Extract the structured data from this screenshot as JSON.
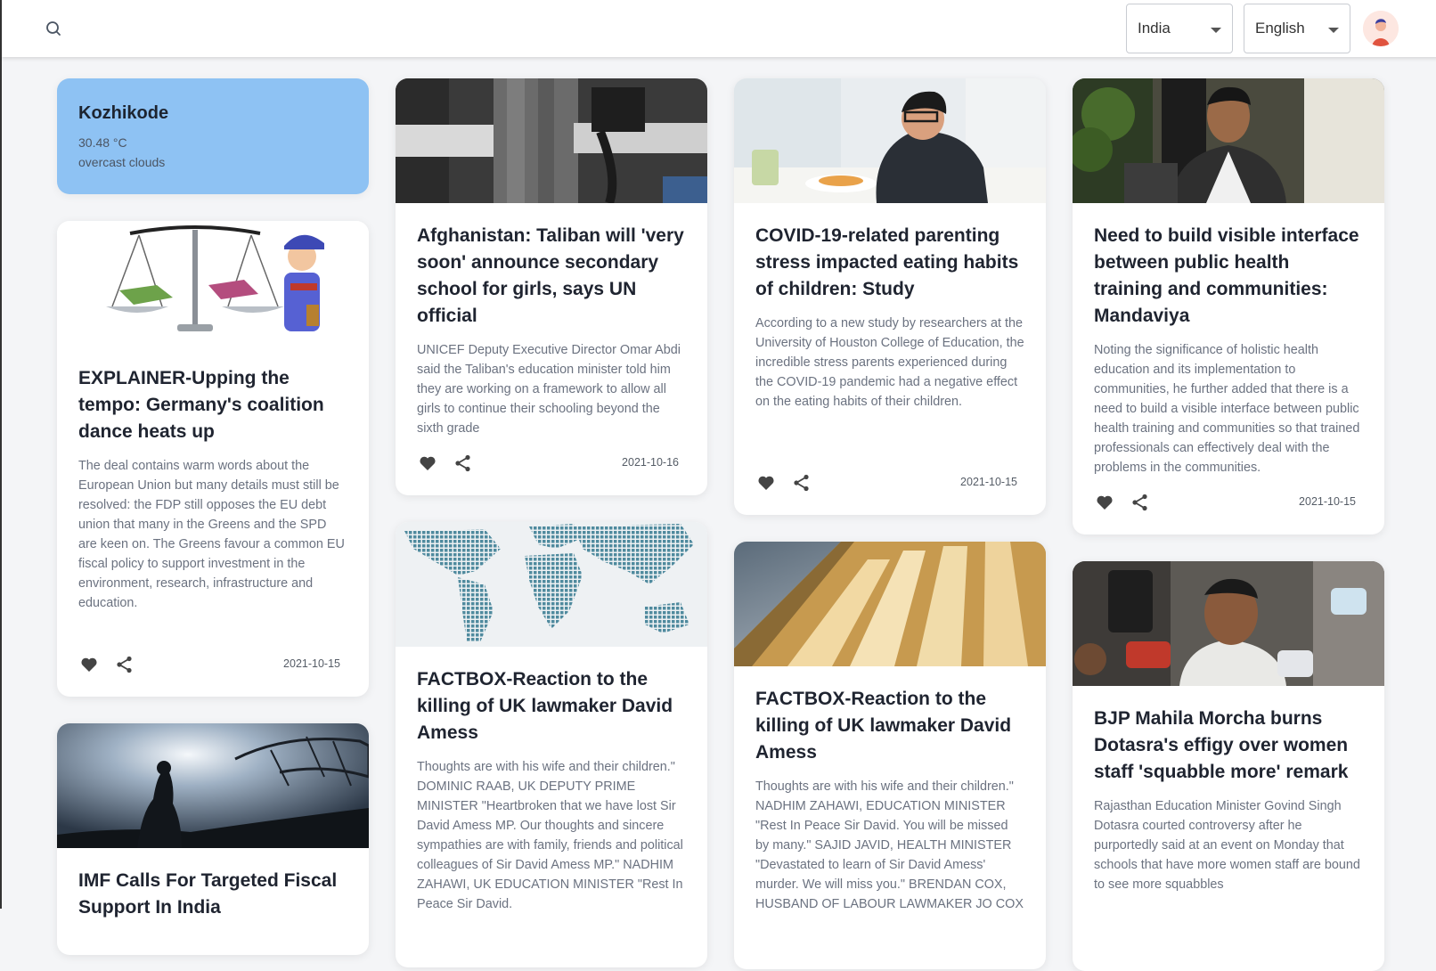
{
  "header": {
    "country": "India",
    "language": "English",
    "icons": {
      "search": "search-icon",
      "avatar": "user-avatar"
    }
  },
  "weather": {
    "city": "Kozhikode",
    "temperature": "30.48 °C",
    "description": "overcast clouds"
  },
  "articles": [
    {
      "title": "EXPLAINER-Upping the tempo: Germany's coalition dance heats up",
      "excerpt": "The deal contains warm words about the European Union but many details must still be resolved: the FDP still opposes the EU debt union that many in the Greens and the SPD are keen on. The Greens favour a common EU fiscal policy to support investment in the environment, research, infrastructure and education.",
      "date": "2021-10-15"
    },
    {
      "title": "IMF Calls For Targeted Fiscal Support In India",
      "excerpt": "",
      "date": ""
    },
    {
      "title": "Afghanistan: Taliban will 'very soon' announce secondary school for girls, says UN official",
      "excerpt": "UNICEF Deputy Executive Director Omar Abdi said the Taliban's education minister told him they are working on a framework to allow all girls to continue their schooling beyond the sixth grade",
      "date": "2021-10-16"
    },
    {
      "title": "FACTBOX-Reaction to the killing of UK lawmaker David Amess",
      "excerpt": "Thoughts are with his wife and their children.\" DOMINIC RAAB, UK DEPUTY PRIME MINISTER \"Heartbroken that we have lost Sir David Amess MP. Our thoughts and sincere sympathies are with family, friends and political colleagues of Sir David Amess MP.\" NADHIM ZAHAWI, UK EDUCATION MINISTER \"Rest In Peace Sir David.",
      "date": ""
    },
    {
      "title": "COVID-19-related parenting stress impacted eating habits of children: Study",
      "excerpt": "According to a new study by researchers at the University of Houston College of Education, the incredible stress parents experienced during the COVID-19 pandemic had a negative effect on the eating habits of their children.",
      "date": "2021-10-15"
    },
    {
      "title": "FACTBOX-Reaction to the killing of UK lawmaker David Amess",
      "excerpt": "Thoughts are with his wife and their children.\" NADHIM ZAHAWI, EDUCATION MINISTER \"Rest In Peace Sir David. You will be missed by many.\" SAJID JAVID, HEALTH MINISTER \"Devastated to learn of Sir David Amess' murder. We will miss you.\" BRENDAN COX, HUSBAND OF LABOUR LAWMAKER JO COX",
      "date": ""
    },
    {
      "title": "Need to build visible interface between public health training and communities: Mandaviya",
      "excerpt": "Noting the significance of holistic health education and its implementation to communities, he further added that there is a need to build a visible interface between public health training and communities so that trained professionals can effectively deal with the problems in the communities.",
      "date": "2021-10-15"
    },
    {
      "title": "BJP Mahila Morcha burns Dotasra's effigy over women staff 'squabble more' remark",
      "excerpt": "Rajasthan Education Minister Govind Singh Dotasra courted controversy after he purportedly said at an event on Monday that schools that have more women staff are bound to see more squabbles",
      "date": ""
    }
  ]
}
